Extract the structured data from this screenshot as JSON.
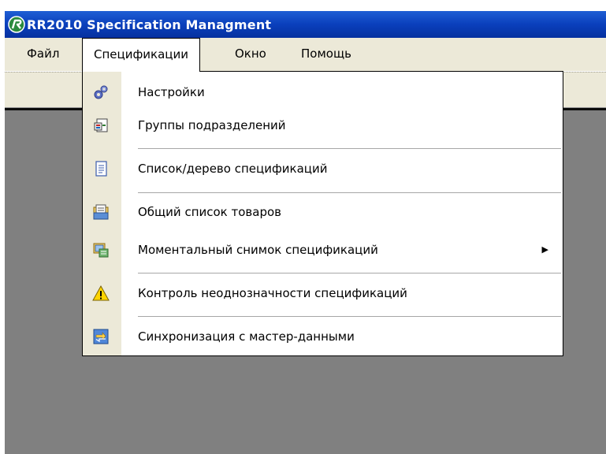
{
  "window": {
    "title": "RR2010 Specification Managment",
    "accent": "#0a3fbc",
    "mdi_background": "#808080"
  },
  "menubar": {
    "items": [
      {
        "label": "Файл"
      },
      {
        "label": "Спецификации",
        "open": true
      },
      {
        "label": "Окно"
      },
      {
        "label": "Помощь"
      }
    ]
  },
  "dropdown": {
    "items": [
      {
        "label": "Настройки",
        "icon": "gears-icon"
      },
      {
        "label": "Группы подразделений",
        "icon": "groups-icon"
      },
      {
        "label": "Список/дерево спецификаций",
        "icon": "document-icon"
      },
      {
        "label": "Общий список товаров",
        "icon": "list-icon"
      },
      {
        "label": "Моментальный снимок спецификаций",
        "icon": "snapshot-icon",
        "submenu_arrow": "▶"
      },
      {
        "label": "Контроль неоднозначности  спецификаций",
        "icon": "warning-icon"
      },
      {
        "label": "Синхронизация с мастер-данными",
        "icon": "sync-icon"
      }
    ]
  }
}
